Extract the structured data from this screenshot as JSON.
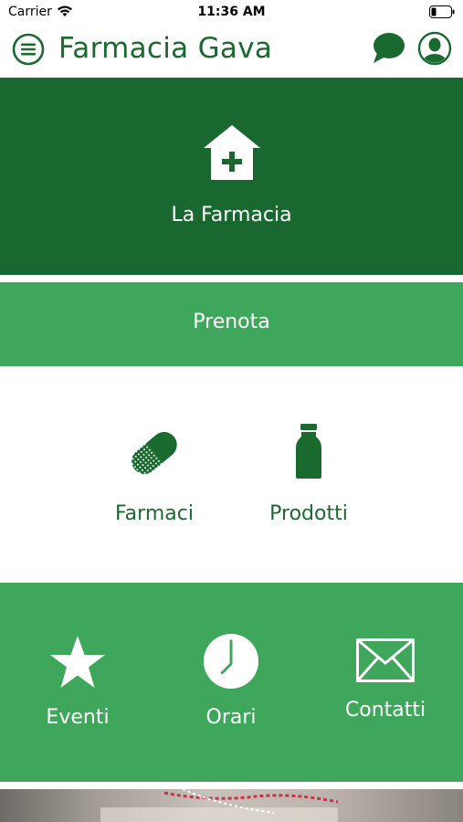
{
  "status_bar": {
    "carrier": "Carrier",
    "time": "11:36 AM"
  },
  "header": {
    "title": "Farmacia Gava"
  },
  "tiles": {
    "farmacia": {
      "label": "La Farmacia"
    },
    "prenota": {
      "label": "Prenota"
    },
    "farmaci": {
      "label": "Farmaci"
    },
    "prodotti": {
      "label": "Prodotti"
    },
    "eventi": {
      "label": "Eventi"
    },
    "orari": {
      "label": "Orari"
    },
    "contatti": {
      "label": "Contatti"
    }
  },
  "colors": {
    "dark_green": "#196830",
    "light_green": "#3fa75b",
    "text_green": "#1a6a30"
  },
  "icons": [
    "menu-icon",
    "chat-icon",
    "profile-icon",
    "home-plus-icon",
    "pill-icon",
    "bottle-icon",
    "star-icon",
    "clock-icon",
    "mail-icon"
  ]
}
